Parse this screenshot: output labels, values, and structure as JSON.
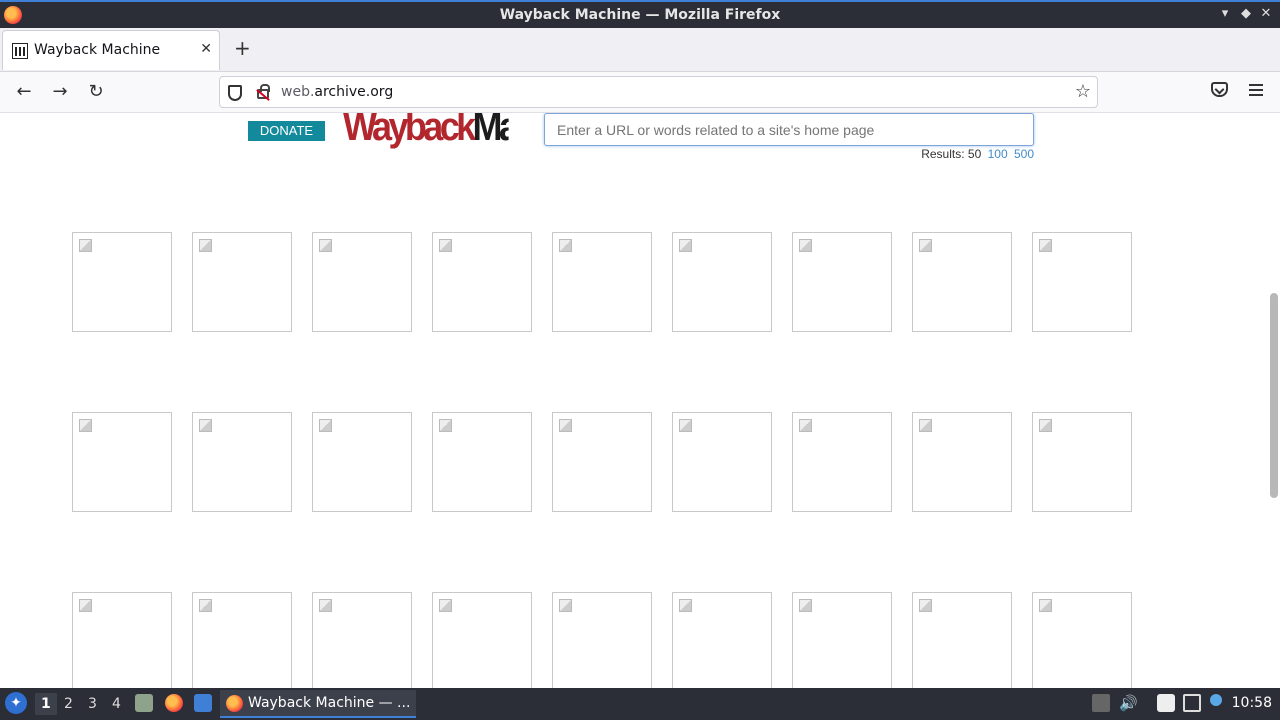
{
  "window": {
    "title": "Wayback Machine — Mozilla Firefox"
  },
  "tabs": [
    {
      "label": "Wayback Machine"
    }
  ],
  "icons": {
    "new_tab": "+",
    "close_tab": "✕",
    "back": "←",
    "forward": "→",
    "reload": "↻",
    "bookmark": "☆",
    "minimize": "▾",
    "maximize": "◆",
    "close": "✕"
  },
  "url": {
    "prefix": "web.",
    "domain": "archive.org"
  },
  "page": {
    "donate_label": "DONATE",
    "logo": {
      "wayback": "Wayback",
      "machine": "Machine"
    },
    "search_placeholder": "Enter a URL or words related to a site's home page",
    "results": {
      "label": "Results: 50",
      "opt100": "100",
      "opt500": "500"
    }
  },
  "taskbar": {
    "workspaces": [
      "1",
      "2",
      "3",
      "4"
    ],
    "task_label": "Wayback Machine — ...",
    "clock": "10:58"
  },
  "colors": {
    "donate": "#138a9c",
    "logo_red": "#b2262d",
    "link": "#428bca"
  }
}
